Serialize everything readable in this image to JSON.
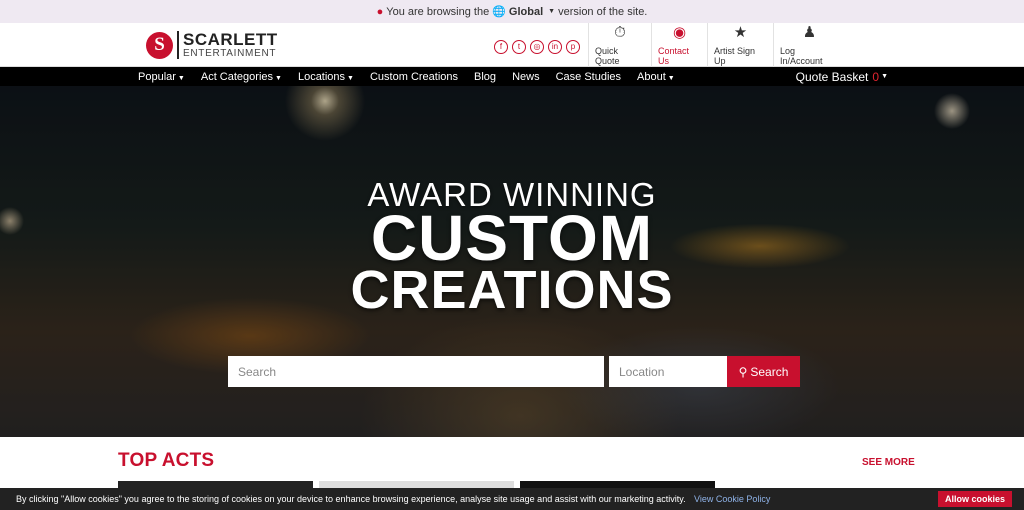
{
  "topbar": {
    "prefix": "You are browsing the",
    "region": "Global",
    "suffix": "version of the site."
  },
  "logo": {
    "mark": "S",
    "name": "SCARLETT",
    "sub": "ENTERTAINMENT"
  },
  "socials": [
    "f",
    "t",
    "◎",
    "in",
    "p"
  ],
  "header_links": [
    {
      "label": "Quick Quote",
      "icon": "quote-icon"
    },
    {
      "label": "Contact Us",
      "icon": "chat-icon"
    },
    {
      "label": "Artist Sign Up",
      "icon": "star-plus-icon"
    },
    {
      "label": "Log In/Account",
      "icon": "user-icon"
    }
  ],
  "nav": {
    "items": [
      "Popular",
      "Act Categories",
      "Locations",
      "Custom Creations",
      "Blog",
      "News",
      "Case Studies",
      "About"
    ],
    "basket_label": "Quote Basket",
    "basket_count": "0"
  },
  "hero": {
    "line1": "AWARD WINNING",
    "line2": "CUSTOM",
    "line3": "CREATIONS",
    "search_placeholder": "Search",
    "location_placeholder": "Location",
    "search_button": "Search"
  },
  "top_acts": {
    "title": "TOP ACTS",
    "see_more": "SEE MORE"
  },
  "cookie": {
    "text": "By clicking \"Allow cookies\" you agree to the storing of cookies on your device to enhance browsing experience, analyse site usage and assist with our marketing activity.",
    "link": "View Cookie Policy",
    "button": "Allow cookies"
  },
  "colors": {
    "brand": "#c8102e",
    "nav_bg": "#000000",
    "topbar_bg": "#efe9f2"
  }
}
